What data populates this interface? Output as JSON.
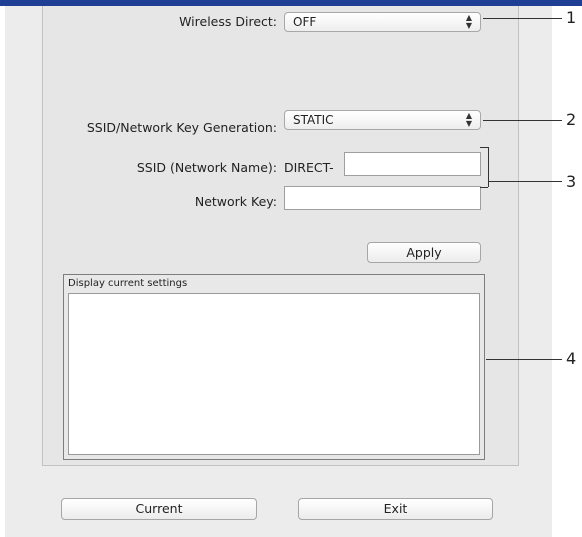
{
  "wireless_direct": {
    "label": "Wireless Direct:",
    "value": "OFF"
  },
  "ssid_key_generation": {
    "label": "SSID/Network Key Generation:",
    "value": "STATIC"
  },
  "ssid": {
    "label": "SSID (Network Name):",
    "prefix": "DIRECT-",
    "value": ""
  },
  "network_key": {
    "label": "Network Key:",
    "value": ""
  },
  "apply_button": "Apply",
  "current_settings": {
    "title": "Display current settings",
    "content": ""
  },
  "current_button": "Current",
  "exit_button": "Exit",
  "popup_arrows": "▲▼",
  "callouts": [
    "1",
    "2",
    "3",
    "4"
  ],
  "colors": {
    "title_bar": "#1f3f94",
    "window_bg": "#ececec",
    "panel_bg": "#e6e6e6"
  }
}
